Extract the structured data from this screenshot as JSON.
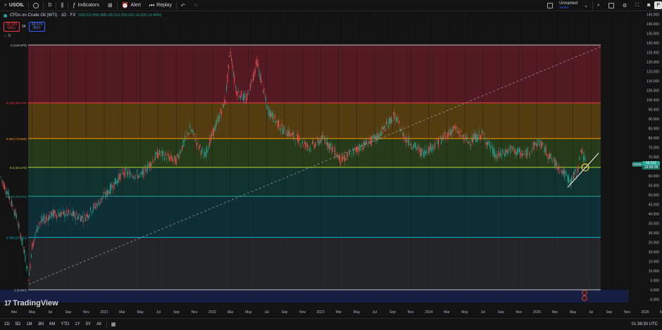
{
  "toolbar": {
    "symbol": "USOIL",
    "interval": "D",
    "indicators_label": "Indicators",
    "alert_label": "Alert",
    "replay_label": "Replay",
    "layout_name": "Unnamed",
    "layout_status": "Saved",
    "publish_label": "P"
  },
  "legend": {
    "title": "CFDs on Crude Oil (WTI) · 1D · FX",
    "ohlc": "O65.312 H65.988 L65.312 C65.532 +0.320 (+0.49%)",
    "sell_price": "65.529",
    "sell_label": "SELL",
    "spread": "34",
    "buy_price": "65.573",
    "buy_label": "BUY",
    "collapse_count": "11"
  },
  "price_axis": {
    "ticks": [
      "145.000",
      "140.000",
      "135.000",
      "130.000",
      "125.000",
      "120.000",
      "115.000",
      "110.000",
      "105.000",
      "100.000",
      "95.000",
      "90.000",
      "85.000",
      "80.000",
      "75.000",
      "70.000",
      "65.000",
      "60.000",
      "55.000",
      "50.000",
      "45.000",
      "40.000",
      "35.000",
      "30.000",
      "25.000",
      "20.000",
      "15.000",
      "10.000",
      "5.000",
      "0.000",
      "-5.000",
      "-10.000"
    ],
    "tick_values": [
      145,
      140,
      135,
      130,
      125,
      120,
      115,
      110,
      105,
      100,
      95,
      90,
      85,
      80,
      75,
      70,
      65,
      60,
      55,
      50,
      45,
      40,
      35,
      30,
      25,
      20,
      15,
      10,
      5,
      0,
      -5,
      -10
    ],
    "current_symbol": "USOIL",
    "current_price": "65.532",
    "countdown": "19:00:28"
  },
  "time_axis": {
    "labels": [
      "Mar",
      "May",
      "Jul",
      "Sep",
      "Nov",
      "2021",
      "Mar",
      "May",
      "Jul",
      "Sep",
      "Nov",
      "2022",
      "Mar",
      "May",
      "Jul",
      "Sep",
      "Nov",
      "2023",
      "Mar",
      "May",
      "Jul",
      "Sep",
      "Nov",
      "2024",
      "Mar",
      "May",
      "Jul",
      "Sep",
      "Nov",
      "2025",
      "Mar",
      "May",
      "Jul",
      "Sep",
      "Nov",
      "2026",
      "Mar"
    ]
  },
  "fib_levels": [
    {
      "label": "0 (128.875)",
      "value": 128.875,
      "color": "#c2c2c2"
    },
    {
      "label": "0.236 (98.475)",
      "value": 98.475,
      "color": "#f23645"
    },
    {
      "label": "0.382 (79.669)",
      "value": 79.669,
      "color": "#ff9800"
    },
    {
      "label": "0.5 (64.470)",
      "value": 64.47,
      "color": "#b2d835"
    },
    {
      "label": "0.618 (49.271)",
      "value": 49.271,
      "color": "#26a69a"
    },
    {
      "label": "0.786 (27.631)",
      "value": 27.631,
      "color": "#00bcd4"
    },
    {
      "label": "1 (0.067)",
      "value": 0.067,
      "color": "#c2c2c2"
    }
  ],
  "bottom": {
    "ranges": [
      "1D",
      "5D",
      "1M",
      "3M",
      "6M",
      "YTD",
      "1Y",
      "5Y",
      "All"
    ],
    "clock": "01:38:30 UTC"
  },
  "branding": {
    "name": "TradingView"
  }
}
